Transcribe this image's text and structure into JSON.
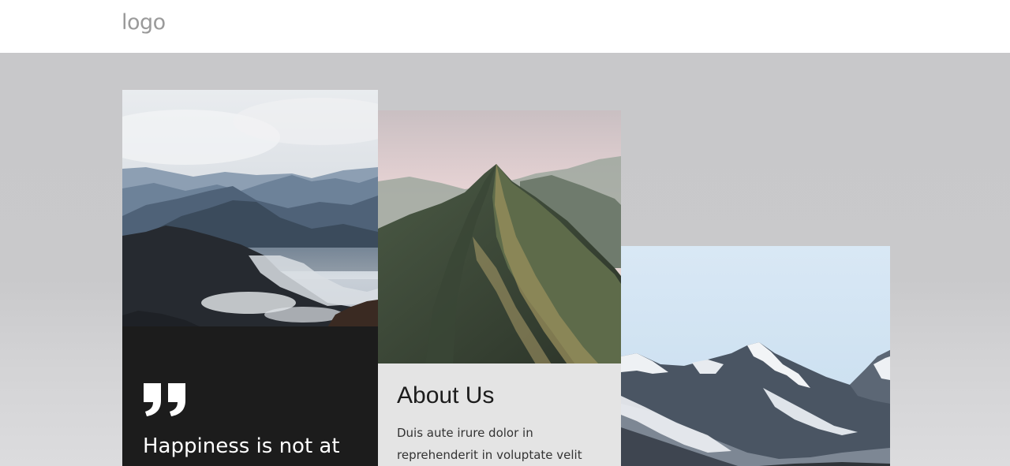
{
  "header": {
    "logo_text": "logo"
  },
  "cards": {
    "quote": {
      "image_alt": "misty-mountain-range-photo",
      "quote_icon": "quotation-mark-icon",
      "text": "Happiness is not at"
    },
    "about": {
      "image_alt": "green-mountain-peak-photo",
      "title": "About Us",
      "body": "Duis aute irure dolor in reprehenderit in voluptate velit esse"
    },
    "landscape": {
      "image_alt": "snowy-mountain-photo"
    }
  },
  "colors": {
    "header_bg": "#ffffff",
    "hero_bg": "#c8c8ca",
    "quote_bg": "#1c1c1c",
    "about_bg": "#e4e4e4",
    "logo": "#9a9a9a"
  }
}
